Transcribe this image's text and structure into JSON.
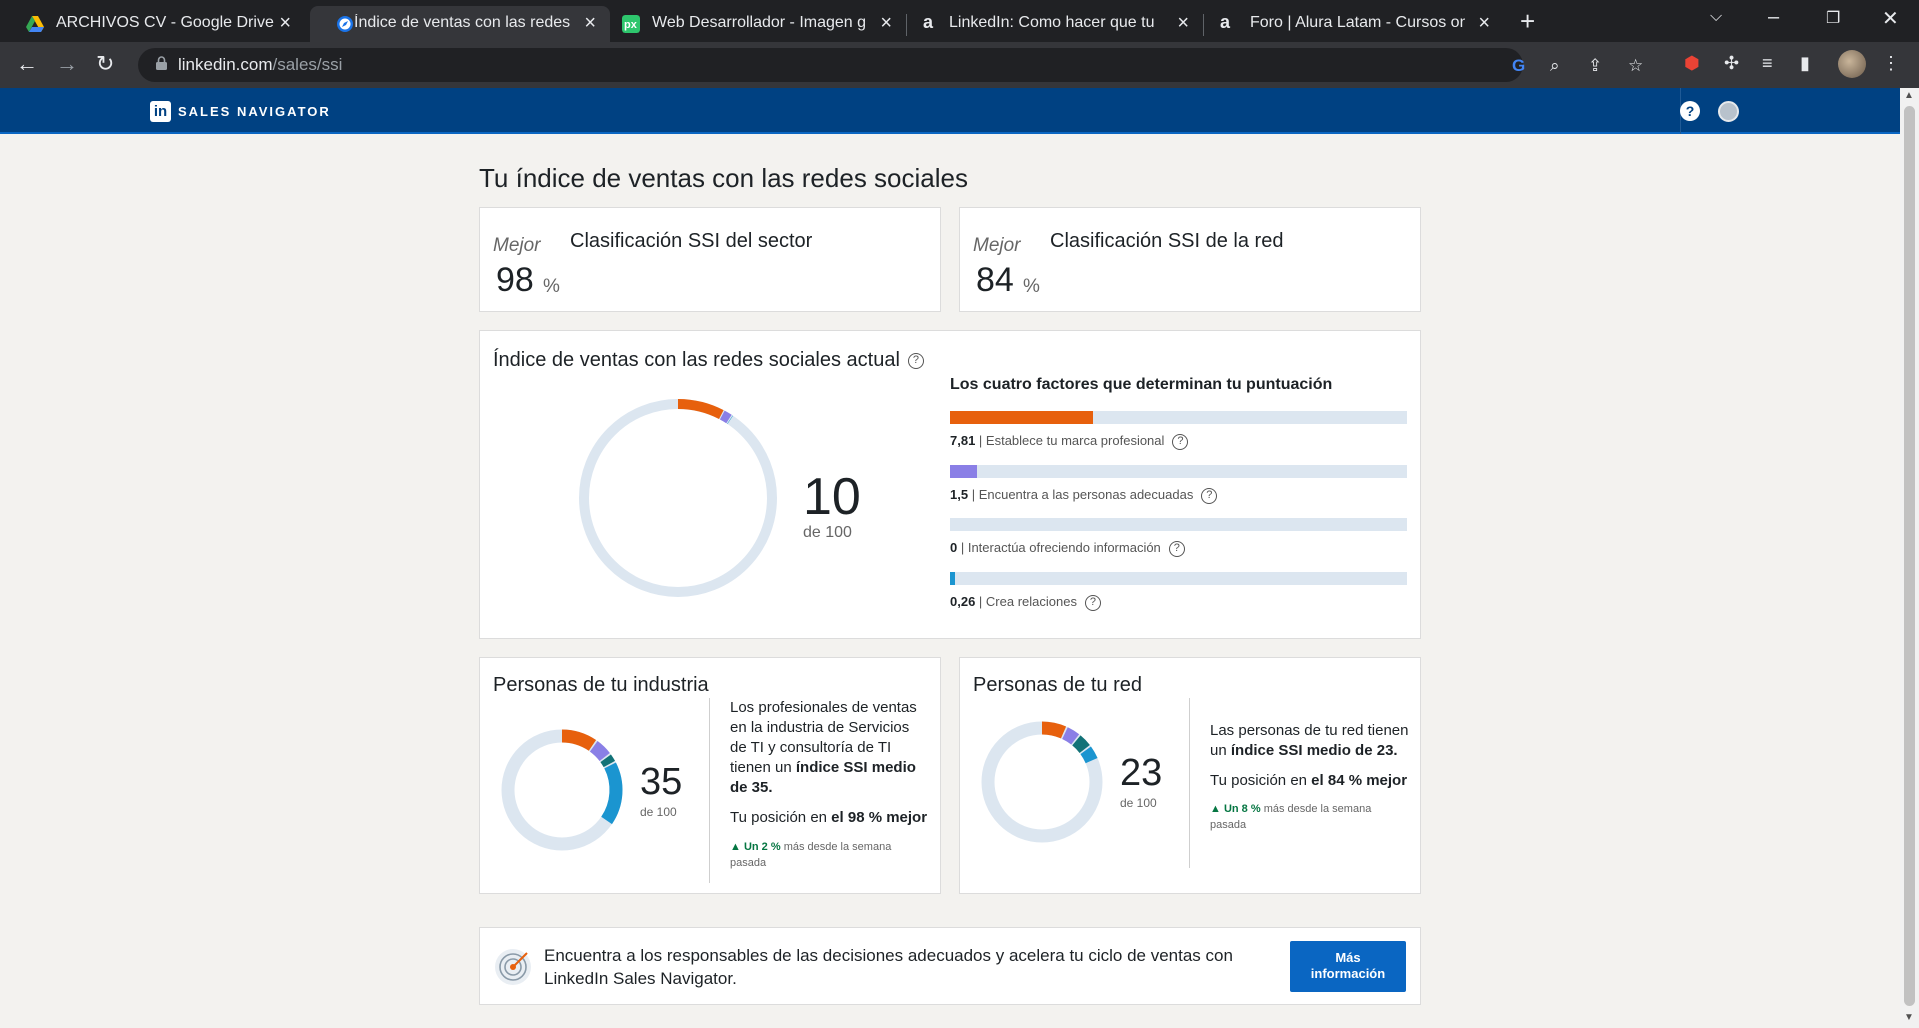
{
  "browser": {
    "tabs": [
      {
        "title": "ARCHIVOS CV - Google Drive",
        "favicon": "google-drive-icon"
      },
      {
        "title": "Índice de ventas con las redes so",
        "favicon": "compass-icon"
      },
      {
        "title": "Web Desarrollador - Imagen grat",
        "favicon": "pixabay-icon"
      },
      {
        "title": "LinkedIn: Como hacer que tu per",
        "favicon": "alura-icon"
      },
      {
        "title": "Foro | Alura Latam - Cursos onlin",
        "favicon": "alura-icon"
      }
    ],
    "url_host": "linkedin.com",
    "url_path": "/sales/ssi"
  },
  "app": {
    "brand": "SALES NAVIGATOR"
  },
  "page": {
    "title": "Tu índice de ventas con las redes sociales"
  },
  "rankings": [
    {
      "mejor": "Mejor",
      "title": "Clasificación SSI del sector",
      "value": "98",
      "unit": "%"
    },
    {
      "mejor": "Mejor",
      "title": "Clasificación SSI de la red",
      "value": "84",
      "unit": "%"
    }
  ],
  "current": {
    "title": "Índice de ventas con las redes sociales actual",
    "score": "10",
    "score_sub": "de 100",
    "factors_title": "Los cuatro factores que determinan tu puntuación",
    "factors": [
      {
        "value": "7,81",
        "label": "Establece tu marca profesional",
        "fraction": 0.312,
        "color": "#e7600d"
      },
      {
        "value": "1,5",
        "label": "Encuentra a las personas adecuadas",
        "fraction": 0.06,
        "color": "#8a7fe6"
      },
      {
        "value": "0",
        "label": "Interactúa ofreciendo información",
        "fraction": 0.0,
        "color": "#127277"
      },
      {
        "value": "0,26",
        "label": "Crea relaciones",
        "fraction": 0.0104,
        "color": "#1b95d0"
      }
    ]
  },
  "industry": {
    "title": "Personas de tu industria",
    "score": "35",
    "score_sub": "de 100",
    "text_1": "Los profesionales de ventas en la industria de Servicios de TI y consultoría de TI tienen un ",
    "text_bold": "índice SSI medio de 35.",
    "position_pre": "Tu posición en ",
    "position_bold": "el 98 % mejor",
    "up_bold": "Un 2 %",
    "up_rest": " más desde la semana pasada",
    "segments": [
      0.1,
      0.05,
      0.025,
      0.175
    ]
  },
  "network": {
    "title": "Personas de tu red",
    "score": "23",
    "score_sub": "de 100",
    "text_1": "Las personas de tu red tienen un ",
    "text_bold": "índice SSI medio de 23.",
    "position_pre": "Tu posición en ",
    "position_bold": "el 84 % mejor",
    "up_bold": "Un 8 %",
    "up_rest": " más desde la semana pasada",
    "segments": [
      0.07,
      0.04,
      0.04,
      0.04
    ]
  },
  "cta": {
    "text": "Encuentra a los responsables de las decisiones adecuados y acelera tu ciclo de ventas con LinkedIn Sales Navigator.",
    "button_line1": "Más",
    "button_line2": "información"
  },
  "colors": {
    "marca": "#e7600d",
    "personas": "#8a7fe6",
    "interactua": "#127277",
    "relaciones": "#1b95d0",
    "track": "#dce6f0"
  }
}
